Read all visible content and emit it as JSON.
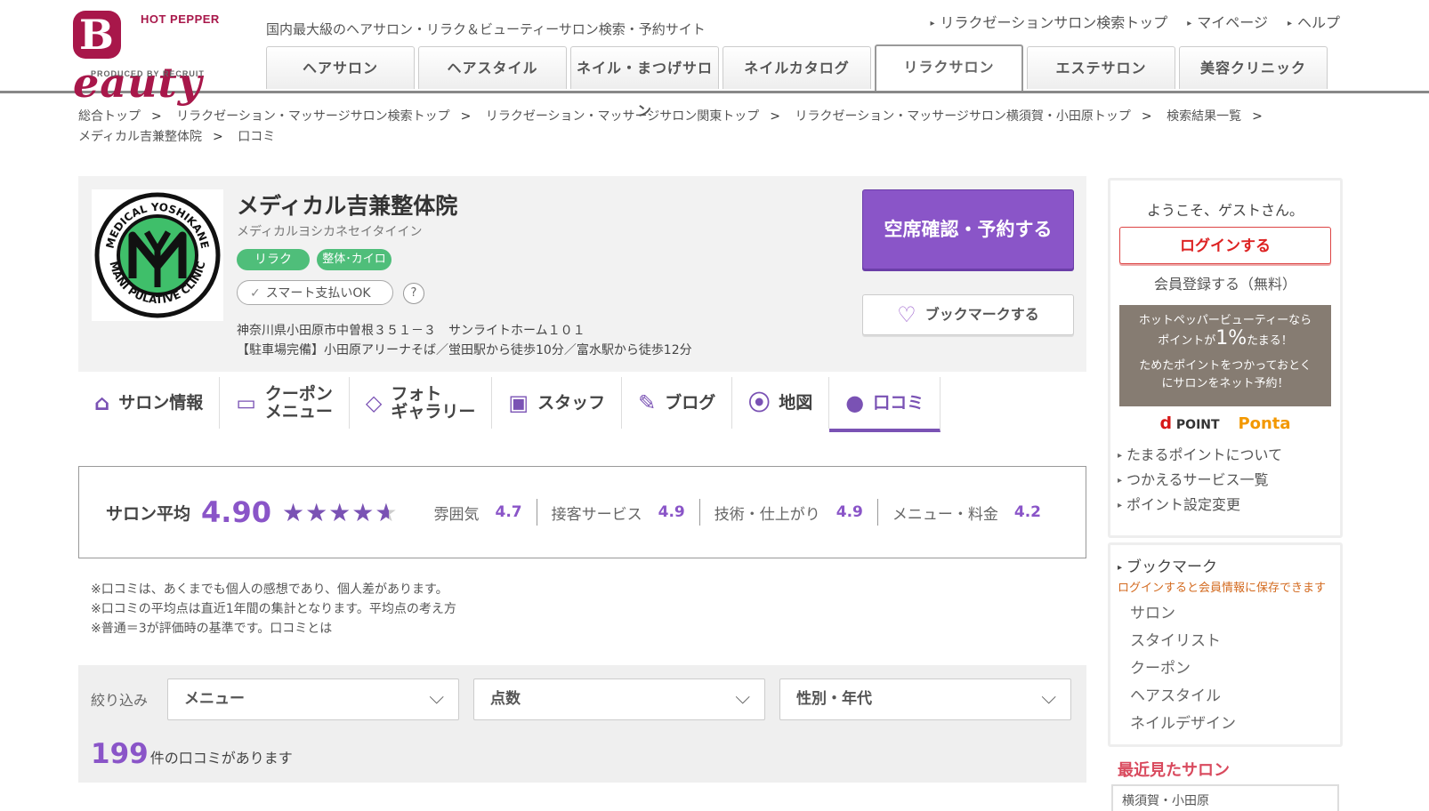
{
  "header": {
    "logo": {
      "top": "HOT PEPPER",
      "main": "Beauty",
      "produced": "PRODUCED BY RECRUIT"
    },
    "tagline": "国内最大級のヘアサロン・リラク＆ビューティーサロン検索・予約サイト",
    "top_links": [
      "リラクゼーションサロン検索トップ",
      "マイページ",
      "ヘルプ"
    ],
    "nav_tabs": [
      "ヘアサロン",
      "ヘアスタイル",
      "ネイル・まつげサロン",
      "ネイルカタログ",
      "リラクサロン",
      "エステサロン",
      "美容クリニック"
    ]
  },
  "breadcrumb": [
    "総合トップ",
    "リラクゼーション・マッサージサロン検索トップ",
    "リラクゼーション・マッサージサロン関東トップ",
    "リラクゼーション・マッサージサロン横須賀・小田原トップ",
    "検索結果一覧",
    "メディカル吉兼整体院",
    "口コミ"
  ],
  "salon": {
    "name": "メディカル吉兼整体院",
    "kana": "メディカルヨシカネセイタイイン",
    "tags": [
      "リラク",
      "整体･カイロ"
    ],
    "smart_pay": "スマート支払いOK",
    "help": "?",
    "address": "神奈川県小田原市中曽根３５１－３　サンライトホーム１０１",
    "access": "【駐車場完備】小田原アリーナそば／蛍田駅から徒歩10分／富水駅から徒歩12分",
    "reserve_button": "空席確認・予約する",
    "bookmark_button": "ブックマークする",
    "logo_text_top": "MEDICAL YOSHIKANE",
    "logo_text_bottom": "MANI PULATIVE CLINIC"
  },
  "subnav": [
    {
      "label": "サロン情報",
      "icon": "house-icon"
    },
    {
      "label": "クーポン\nメニュー",
      "icon": "coupon-icon"
    },
    {
      "label": "フォト\nギャラリー",
      "icon": "photo-icon"
    },
    {
      "label": "スタッフ",
      "icon": "staff-card-icon"
    },
    {
      "label": "ブログ",
      "icon": "pencil-icon"
    },
    {
      "label": "地図",
      "icon": "map-pin-icon"
    },
    {
      "label": "口コミ",
      "icon": "speech-bubble-icon"
    }
  ],
  "rating": {
    "label": "サロン平均",
    "average": "4.90",
    "stars": 4.9,
    "subs": [
      {
        "label": "雰囲気",
        "value": "4.7"
      },
      {
        "label": "接客サービス",
        "value": "4.9"
      },
      {
        "label": "技術・仕上がり",
        "value": "4.9"
      },
      {
        "label": "メニュー・料金",
        "value": "4.2"
      }
    ]
  },
  "notes": [
    "※口コミは、あくまでも個人の感想であり、個人差があります。",
    "※口コミの平均点は直近1年間の集計となります。平均点の考え方",
    "※普通＝3が評価時の基準です。口コミとは"
  ],
  "filter": {
    "label": "絞り込み",
    "selects": [
      "メニュー",
      "点数",
      "性別・年代"
    ],
    "count": "199",
    "count_suffix": "件の口コミがあります"
  },
  "sidebar": {
    "welcome": "ようこそ、ゲストさん。",
    "login": "ログインする",
    "register": "会員登録する（無料）",
    "point_banner_1": "ホットペッパービューティーなら",
    "point_banner_2a": "ポイントが",
    "point_banner_pct": "1%",
    "point_banner_2b": "たまる！",
    "point_banner_3": "ためたポイントをつかっておとく",
    "point_banner_4": "にサロンをネット予約！",
    "point_logo_d": "d",
    "point_logo_dpoint": "POINT",
    "point_logo_ponta": "Ponta",
    "point_links": [
      "たまるポイントについて",
      "つかえるサービス一覧",
      "ポイント設定変更"
    ],
    "bookmark_title": "ブックマーク",
    "bookmark_note": "ログインすると会員情報に保存できます",
    "bookmark_items": [
      "サロン",
      "スタイリスト",
      "クーポン",
      "ヘアスタイル",
      "ネイルデザイン"
    ],
    "recent_title": "最近見たサロン",
    "recent_item": "横須賀・小田原"
  },
  "colors": {
    "brand": "#a8174a",
    "accent": "#8a55c8",
    "tag": "#4fbe7a",
    "login": "#dd2222"
  }
}
